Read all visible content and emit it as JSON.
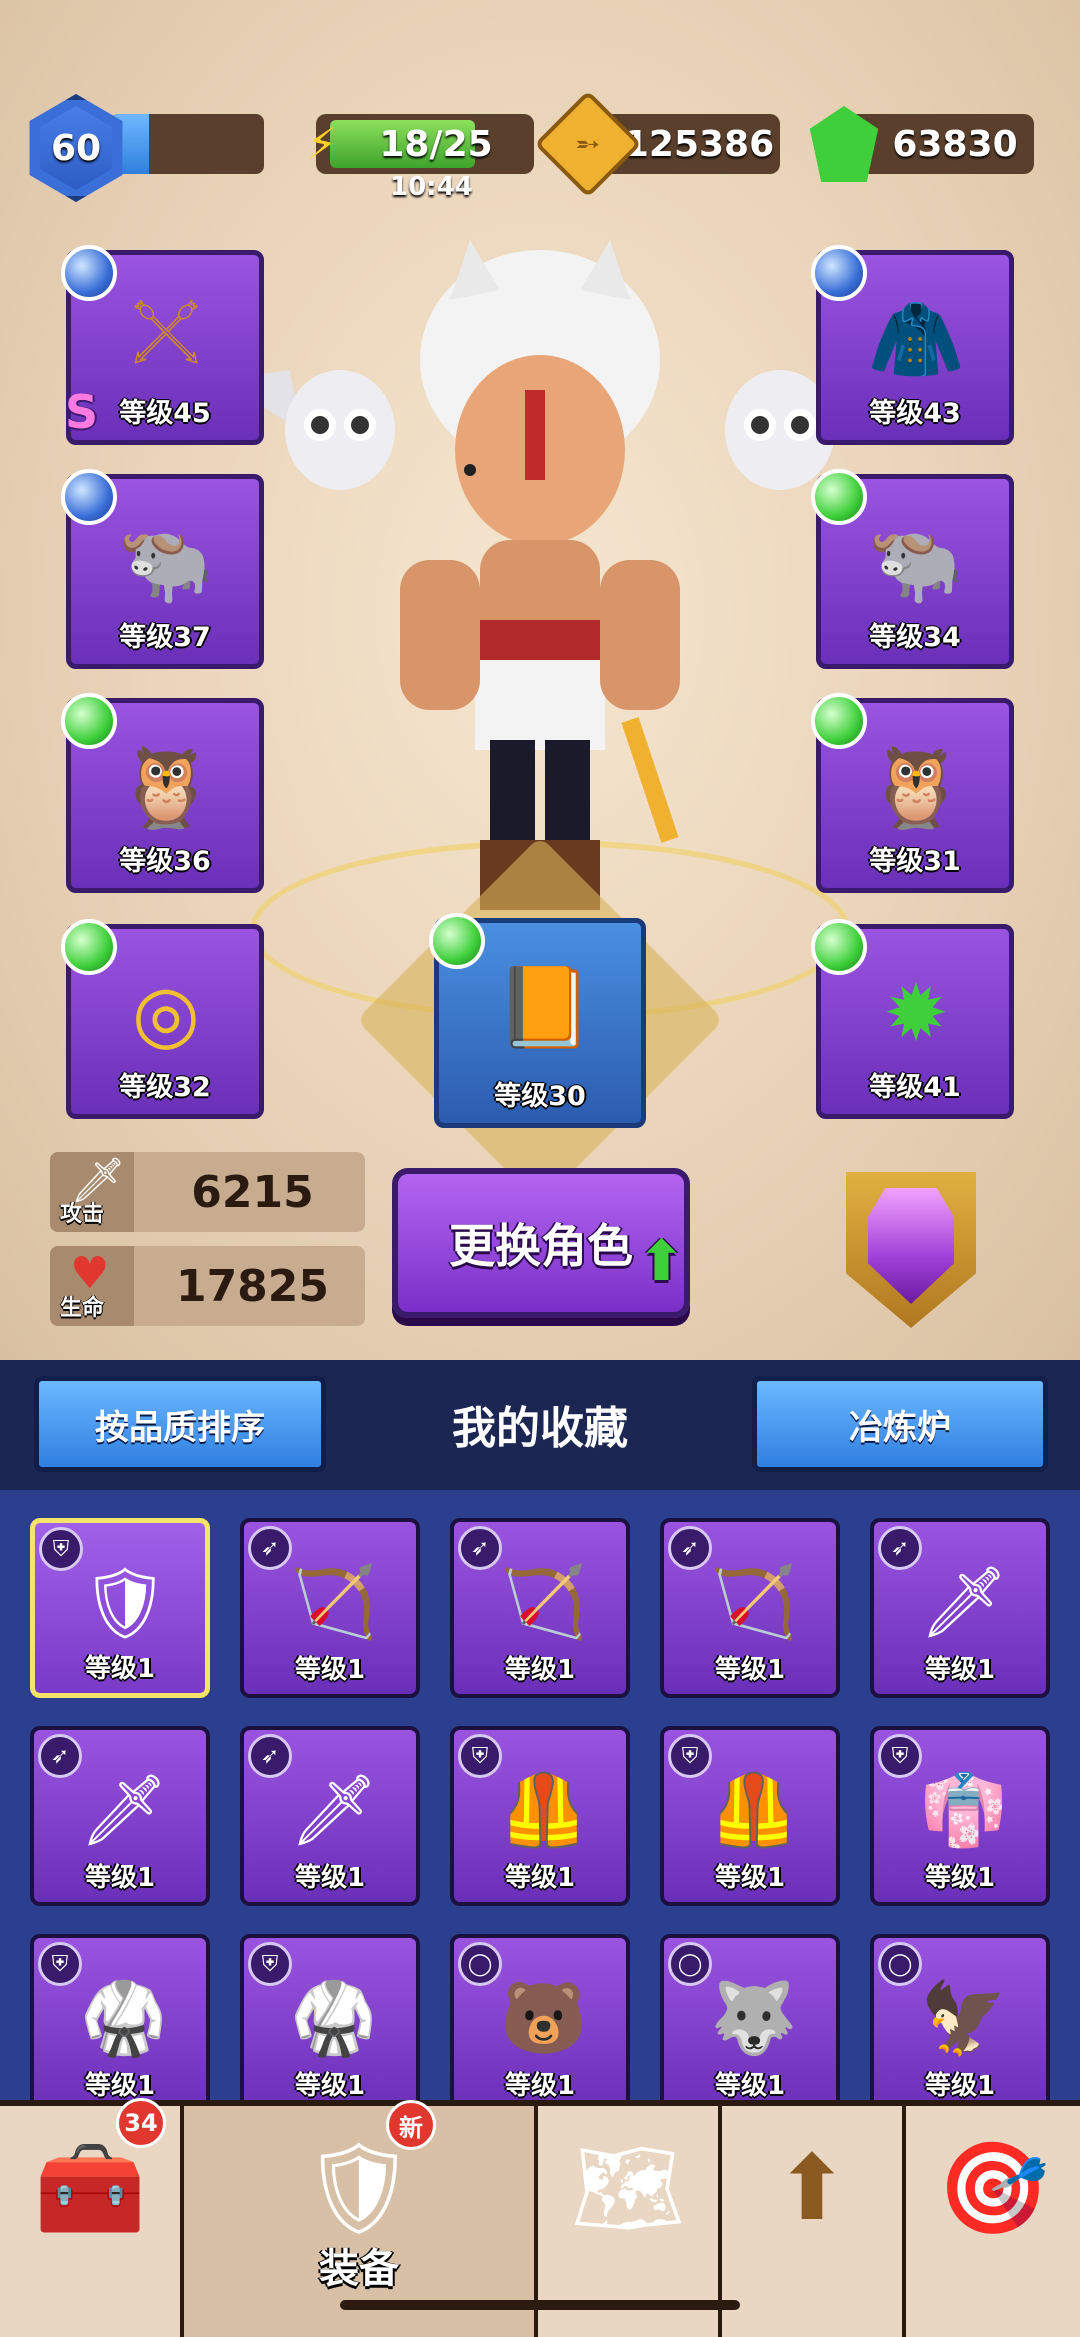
{
  "header": {
    "player_level": "60",
    "xp_progress": 0.25,
    "energy": "18/25",
    "energy_progress": 0.72,
    "energy_timer": "10:44",
    "gold": "125386",
    "gems": "63830"
  },
  "equipment_slots": {
    "weapon": {
      "label": "等级45",
      "gem": "blue",
      "rank": "S",
      "icon": "staff-icon"
    },
    "armor": {
      "label": "等级43",
      "gem": "blue",
      "icon": "cloak-icon"
    },
    "ring_left": {
      "label": "等级37",
      "gem": "blue",
      "icon": "bull-ring-icon"
    },
    "ring_right": {
      "label": "等级34",
      "gem": "green",
      "icon": "bull-ring-icon"
    },
    "pet_left": {
      "label": "等级36",
      "gem": "green",
      "icon": "owl-icon"
    },
    "pet_right": {
      "label": "等级31",
      "gem": "green",
      "icon": "owl-icon"
    },
    "bracelet": {
      "label": "等级32",
      "gem": "green",
      "icon": "bracelet-icon"
    },
    "book": {
      "label": "等级30",
      "gem": "green",
      "icon": "spellbook-icon"
    },
    "amulet": {
      "label": "等级41",
      "gem": "green",
      "icon": "amulet-icon"
    }
  },
  "stats": {
    "attack_label": "攻击",
    "attack_value": "6215",
    "hp_label": "生命",
    "hp_value": "17825"
  },
  "change_hero_button": "更换角色",
  "collection_bar": {
    "sort_button": "按品质排序",
    "title": "我的收藏",
    "smelter_button": "冶炼炉"
  },
  "inventory": [
    {
      "label": "等级1",
      "type_icon": "armor-type-icon",
      "icon": "golden-armor-icon",
      "selected": true
    },
    {
      "label": "等级1",
      "type_icon": "bow-type-icon",
      "icon": "bow-icon"
    },
    {
      "label": "等级1",
      "type_icon": "bow-type-icon",
      "icon": "bow-icon"
    },
    {
      "label": "等级1",
      "type_icon": "bow-type-icon",
      "icon": "bow-icon"
    },
    {
      "label": "等级1",
      "type_icon": "bow-type-icon",
      "icon": "sword-icon"
    },
    {
      "label": "等级1",
      "type_icon": "bow-type-icon",
      "icon": "sword-icon"
    },
    {
      "label": "等级1",
      "type_icon": "bow-type-icon",
      "icon": "sword-icon"
    },
    {
      "label": "等级1",
      "type_icon": "armor-type-icon",
      "icon": "gold-armor-icon"
    },
    {
      "label": "等级1",
      "type_icon": "armor-type-icon",
      "icon": "gold-armor-icon"
    },
    {
      "label": "等级1",
      "type_icon": "armor-type-icon",
      "icon": "robe-icon"
    },
    {
      "label": "等级1",
      "type_icon": "armor-type-icon",
      "icon": "dark-armor-icon"
    },
    {
      "label": "等级1",
      "type_icon": "armor-type-icon",
      "icon": "dark-armor-icon"
    },
    {
      "label": "等级1",
      "type_icon": "ring-type-icon",
      "icon": "bear-ring-icon"
    },
    {
      "label": "等级1",
      "type_icon": "ring-type-icon",
      "icon": "wolf-ring-icon"
    },
    {
      "label": "等级1",
      "type_icon": "ring-type-icon",
      "icon": "eagle-ring-icon"
    }
  ],
  "bottom_nav": [
    {
      "name": "chest",
      "label": "",
      "badge": "34",
      "icon": "chest-icon"
    },
    {
      "name": "equipment",
      "label": "装备",
      "badge": "新",
      "icon": "armor-icon",
      "active": true
    },
    {
      "name": "map",
      "label": "",
      "icon": "map-icon"
    },
    {
      "name": "upgrade",
      "label": "",
      "icon": "upgrade-icon"
    },
    {
      "name": "target",
      "label": "",
      "icon": "target-icon"
    }
  ],
  "colors": {
    "slot_purple": "#7a3ac8",
    "slot_blue": "#2f7fe0",
    "gem_green": "#3ecf3a",
    "gem_blue": "#3a6fd8",
    "panel_bg": "#2b3f8e"
  }
}
